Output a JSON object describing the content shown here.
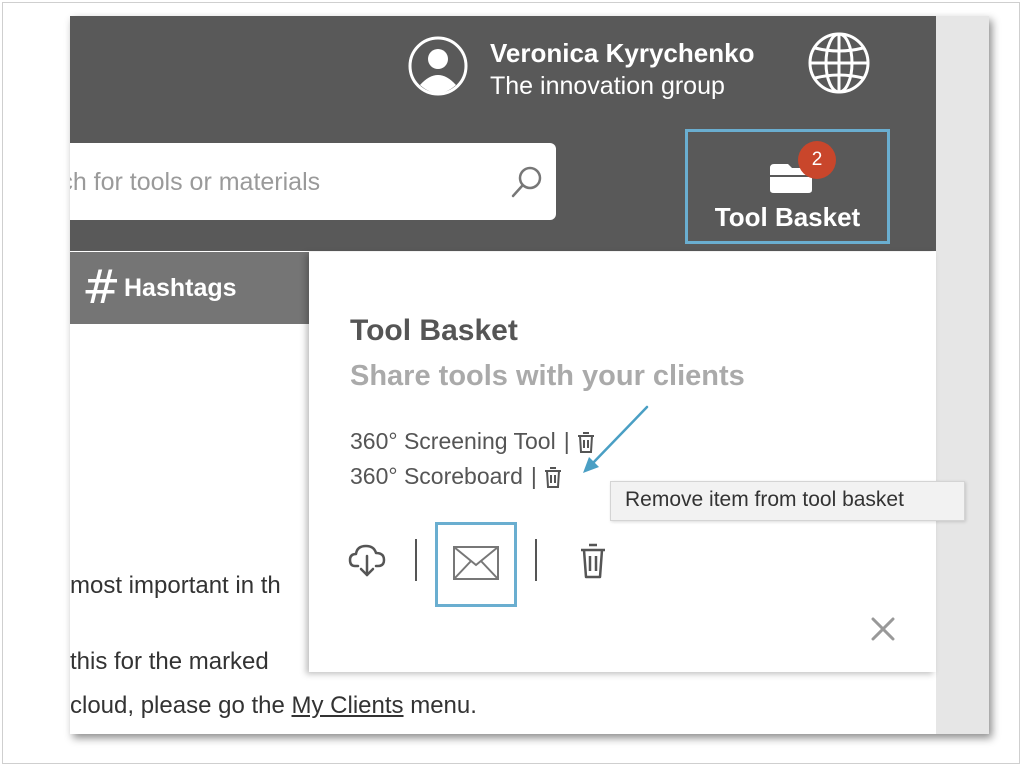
{
  "user": {
    "name": "Veronica Kyrychenko",
    "organization": "The innovation group",
    "avatar_icon": "user-avatar-icon",
    "language_icon": "globe-icon"
  },
  "search": {
    "placeholder": "rch for tools or materials",
    "icon": "search-icon"
  },
  "tool_basket_button": {
    "label": "Tool Basket",
    "badge_count": "2",
    "icon": "basket-icon"
  },
  "tabs": {
    "hashtags_label": "Hashtags"
  },
  "background_text": {
    "line1": "most important in th",
    "line2": "this for the marked",
    "line3_before": "cloud, please go the ",
    "line3_link": "My Clients",
    "line3_after": " menu."
  },
  "basket_popup": {
    "title": "Tool Basket",
    "subtitle": "Share tools with your clients",
    "items": [
      {
        "name": "360° Screening Tool",
        "separator": "|"
      },
      {
        "name": "360° Scoreboard",
        "separator": "|"
      }
    ],
    "actions": [
      "download-icon",
      "email-icon",
      "trash-icon"
    ],
    "close_icon": "close-icon"
  },
  "tooltip": {
    "text": "Remove item from tool basket"
  },
  "colors": {
    "header_bg": "#595959",
    "tab_bg": "#757575",
    "highlight_border": "#6aaed0",
    "badge": "#c9462b",
    "annotation_arrow": "#4a9fc4"
  }
}
